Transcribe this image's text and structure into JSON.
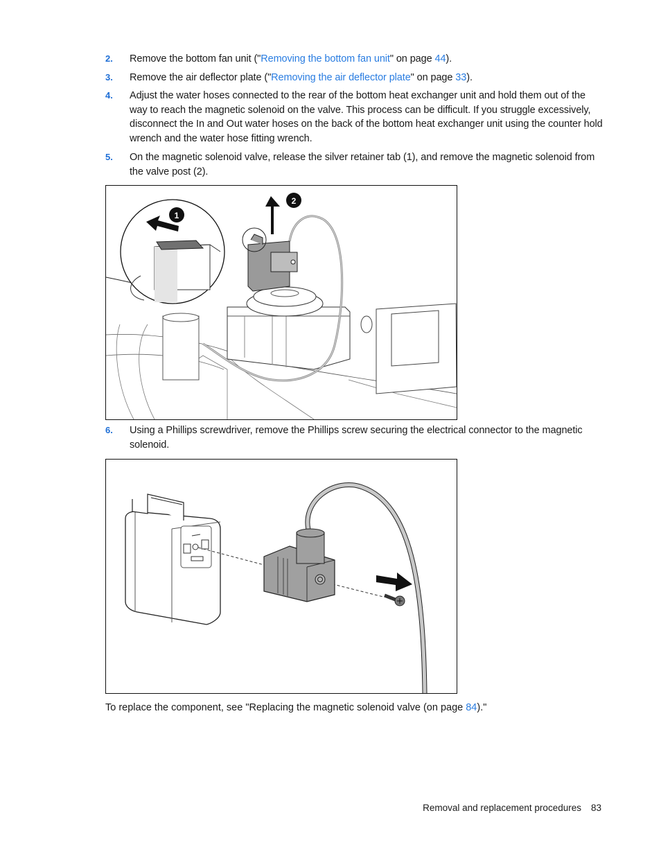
{
  "steps": [
    {
      "num": "2.",
      "pre": "Remove the bottom fan unit (\"",
      "link": "Removing the bottom fan unit",
      "mid": "\" on page ",
      "page": "44",
      "post": ")."
    },
    {
      "num": "3.",
      "pre": "Remove the air deflector plate (\"",
      "link": "Removing the air deflector plate",
      "mid": "\" on page ",
      "page": "33",
      "post": ")."
    },
    {
      "num": "4.",
      "text": "Adjust the water hoses connected to the rear of the bottom heat exchanger unit and hold them out of the way to reach the magnetic solenoid on the valve. This process can be difficult. If you struggle excessively, disconnect the In and Out water hoses on the back of the bottom heat exchanger unit using the counter hold wrench and the water hose fitting wrench."
    },
    {
      "num": "5.",
      "text": "On the magnetic solenoid valve, release the silver retainer tab (1), and remove the magnetic solenoid from the valve post (2)."
    },
    {
      "num": "6.",
      "text": "Using a Phillips screwdriver, remove the Phillips screw securing the electrical connector to the magnetic solenoid."
    }
  ],
  "figure1": {
    "callouts": [
      "1",
      "2"
    ]
  },
  "closing": {
    "pre": "To replace the component, see \"Replacing the magnetic solenoid valve (on page ",
    "page": "84",
    "post": ").\""
  },
  "footer": {
    "section": "Removal and replacement procedures",
    "page": "83"
  },
  "colors": {
    "step_number": "#1f6fd6",
    "link": "#2a7de1"
  }
}
